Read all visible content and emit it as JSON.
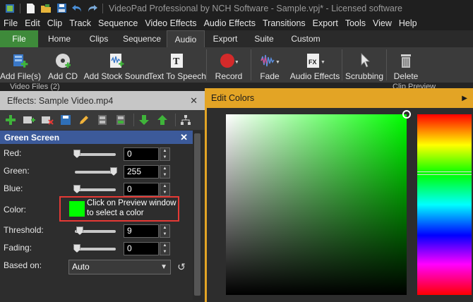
{
  "window": {
    "title": "VideoPad Professional by NCH Software - Sample.vpj* - Licensed software"
  },
  "menu": [
    "File",
    "Edit",
    "Clip",
    "Track",
    "Sequence",
    "Video Effects",
    "Audio Effects",
    "Transitions",
    "Export",
    "Tools",
    "View",
    "Help"
  ],
  "tabs": [
    "File",
    "Home",
    "Clips",
    "Sequence",
    "Audio",
    "Export",
    "Suite",
    "Custom"
  ],
  "active_tab": "Audio",
  "ribbon": {
    "add_files": "Add File(s)",
    "add_cd": "Add CD",
    "add_stock_sound": "Add Stock Sound",
    "text_to_speech": "Text To Speech",
    "record": "Record",
    "fade": "Fade",
    "audio_effects": "Audio Effects",
    "scrubbing": "Scrubbing",
    "delete": "Delete"
  },
  "dock_strip": {
    "left": "Video Files (2)",
    "right": "Clip Preview"
  },
  "effects_panel": {
    "title": "Effects: Sample Video.mp4",
    "close": "✕",
    "effect_name": "Green Screen",
    "effect_close": "✕",
    "red": {
      "label": "Red:",
      "value": "0"
    },
    "green": {
      "label": "Green:",
      "value": "255"
    },
    "blue": {
      "label": "Blue:",
      "value": "0"
    },
    "color": {
      "label": "Color:",
      "hint_line1": "Click on Preview window",
      "hint_line2": "to select a color",
      "swatch": "#00ff00"
    },
    "threshold": {
      "label": "Threshold:",
      "value": "9"
    },
    "fading": {
      "label": "Fading:",
      "value": "0"
    },
    "based_on": {
      "label": "Based on:",
      "value": "Auto"
    }
  },
  "edit_colors": {
    "title": "Edit Colors",
    "selected_color": "#00ff00",
    "hue_marker": "green"
  },
  "colors": {
    "accent_orange": "#e3a425",
    "file_tab_green": "#3e8a3a",
    "effect_header_blue": "#3c5a9a",
    "highlight_red": "#e53935"
  }
}
